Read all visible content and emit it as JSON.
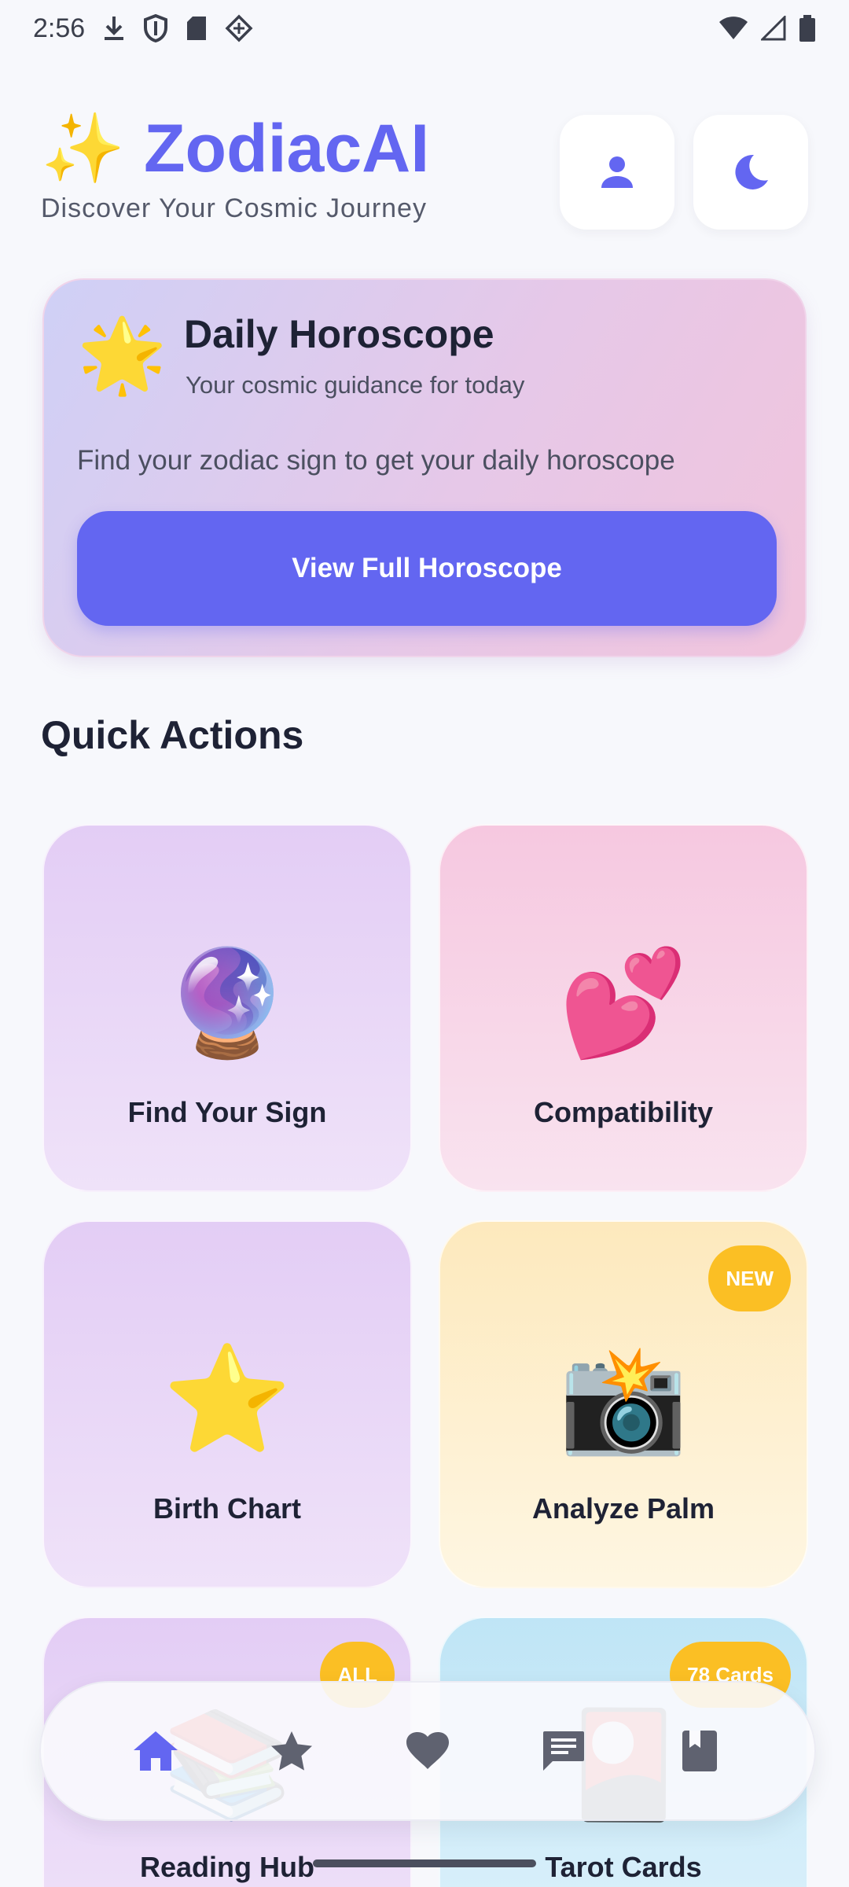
{
  "status_bar": {
    "time": "2:56",
    "left_icons": [
      "download-icon",
      "shield-icon",
      "sd-card-icon",
      "diamond-icon"
    ],
    "right_icons": [
      "wifi-icon",
      "signal-icon",
      "battery-icon"
    ]
  },
  "header": {
    "sparkle": "✨",
    "title": "ZodiacAI",
    "subtitle": "Discover Your Cosmic Journey"
  },
  "horoscope": {
    "icon": "🌟",
    "title": "Daily Horoscope",
    "subtitle": "Your cosmic guidance for today",
    "description": "Find your zodiac sign to get your daily horoscope",
    "button_label": "View Full Horoscope"
  },
  "quick_actions": {
    "title": "Quick Actions",
    "items": [
      {
        "emoji": "🔮",
        "label": "Find Your Sign",
        "badge": ""
      },
      {
        "emoji": "💕",
        "label": "Compatibility",
        "badge": ""
      },
      {
        "emoji": "⭐",
        "label": "Birth Chart",
        "badge": ""
      },
      {
        "emoji": "📸",
        "label": "Analyze Palm",
        "badge": "NEW"
      },
      {
        "emoji": "📚",
        "label": "Reading Hub",
        "badge": "ALL"
      },
      {
        "emoji": "🎴",
        "label": "Tarot Cards",
        "badge": "78 Cards"
      }
    ]
  },
  "bottom_nav": {
    "items": [
      "home-icon",
      "star-icon",
      "heart-icon",
      "chat-icon",
      "book-icon"
    ],
    "active": "home-icon"
  },
  "colors": {
    "accent": "#6366f1",
    "badge": "#fbbf24",
    "text": "#1e2235"
  }
}
